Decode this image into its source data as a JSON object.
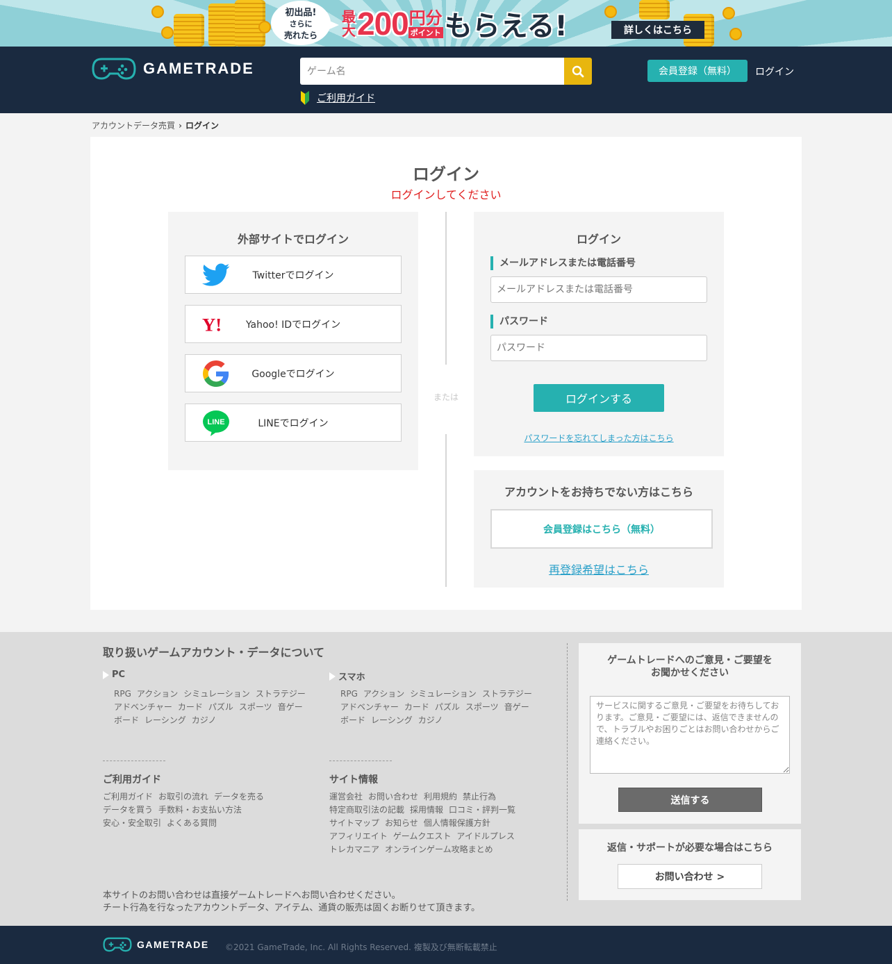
{
  "colors": {
    "header_bg": "#1a2a40",
    "accent_teal": "#26b1b0",
    "search_button": "#e8b60e",
    "error_red": "#e01e1e",
    "link_blue": "#2aa0c9"
  },
  "banner": {
    "bubble_line1": "初出品!",
    "bubble_line2": "さらに",
    "bubble_line3": "売れたら",
    "promo_prefix": "最大",
    "promo_amount": "200",
    "promo_unit_top": "円分",
    "promo_unit_bottom": "ポイント",
    "promo_suffix": "もらえる!",
    "cta_label": "詳しくはこちら"
  },
  "header": {
    "logo_text": "GAMETRADE",
    "search_placeholder": "ゲーム名",
    "search_icon": "search-icon",
    "guide_link": "ご利用ガイド",
    "guide_icon": "beginner-mark-icon",
    "register_button": "会員登録（無料）",
    "login_link": "ログイン"
  },
  "breadcrumb": {
    "parent": "アカウントデータ売買",
    "current": "ログイン"
  },
  "main": {
    "title": "ログイン",
    "subtitle": "ログインしてください",
    "social": {
      "title": "外部サイトでログイン",
      "buttons": [
        {
          "label": "Twitterでログイン",
          "icon": "twitter-icon"
        },
        {
          "label": "Yahoo! IDでログイン",
          "icon": "yahoo-icon"
        },
        {
          "label": "Googleでログイン",
          "icon": "google-icon"
        },
        {
          "label": "LINEでログイン",
          "icon": "line-icon"
        }
      ]
    },
    "or_label": "または",
    "login": {
      "title": "ログイン",
      "email_label": "メールアドレスまたは電話番号",
      "email_placeholder": "メールアドレスまたは電話番号",
      "password_label": "パスワード",
      "password_placeholder": "パスワード",
      "submit": "ログインする",
      "forgot_link": "パスワードを忘れてしまった方はこちら"
    },
    "signup": {
      "title": "アカウントをお持ちでない方はこちら",
      "button": "会員登録はこちら（無料）",
      "reregister_link": "再登録希望はこちら"
    }
  },
  "footer": {
    "genre_title": "取り扱いゲームアカウント・データについて",
    "categories": [
      {
        "name": "PC",
        "genres": [
          "RPG",
          "アクション",
          "シミュレーション",
          "ストラテジー",
          "アドベンチャー",
          "カード",
          "パズル",
          "スポーツ",
          "音ゲー",
          "ボード",
          "レーシング",
          "カジノ"
        ]
      },
      {
        "name": "スマホ",
        "genres": [
          "RPG",
          "アクション",
          "シミュレーション",
          "ストラテジー",
          "アドベンチャー",
          "カード",
          "パズル",
          "スポーツ",
          "音ゲー",
          "ボード",
          "レーシング",
          "カジノ"
        ]
      }
    ],
    "guide": {
      "title": "ご利用ガイド",
      "links": [
        "ご利用ガイド",
        "お取引の流れ",
        "データを売る",
        "データを買う",
        "手数料・お支払い方法",
        "安心・安全取引",
        "よくある質問"
      ]
    },
    "site": {
      "title": "サイト情報",
      "links": [
        "運営会社",
        "お問い合わせ",
        "利用規約",
        "禁止行為",
        "特定商取引法の記載",
        "採用情報",
        "口コミ・評判一覧",
        "サイトマップ",
        "お知らせ",
        "個人情報保護方針",
        "アフィリエイト",
        "ゲームクエスト",
        "アイドルプレス",
        "トレカマニア",
        "オンラインゲーム攻略まとめ"
      ]
    },
    "note_line1": "本サイトのお問い合わせは直接ゲームトレードへお問い合わせください。",
    "note_line2": "チート行為を行なったアカウントデータ、アイテム、通貨の販売は固くお断りせて頂きます。",
    "feedback": {
      "title_line1": "ゲームトレードへのご意見・ご要望を",
      "title_line2": "お聞かせください",
      "placeholder": "サービスに関するご意見・ご要望をお待ちしております。ご意見・ご要望には、返信できませんので、トラブルやお困りごとはお問い合わせからご連絡ください。",
      "submit": "送信する"
    },
    "support": {
      "title": "返信・サポートが必要な場合はこちら",
      "button": "お問い合わせ >"
    }
  },
  "bottom": {
    "logo_text": "GAMETRADE",
    "copyright": "©2021 GameTrade, Inc. All Rights Reserved. 複製及び無断転載禁止"
  }
}
